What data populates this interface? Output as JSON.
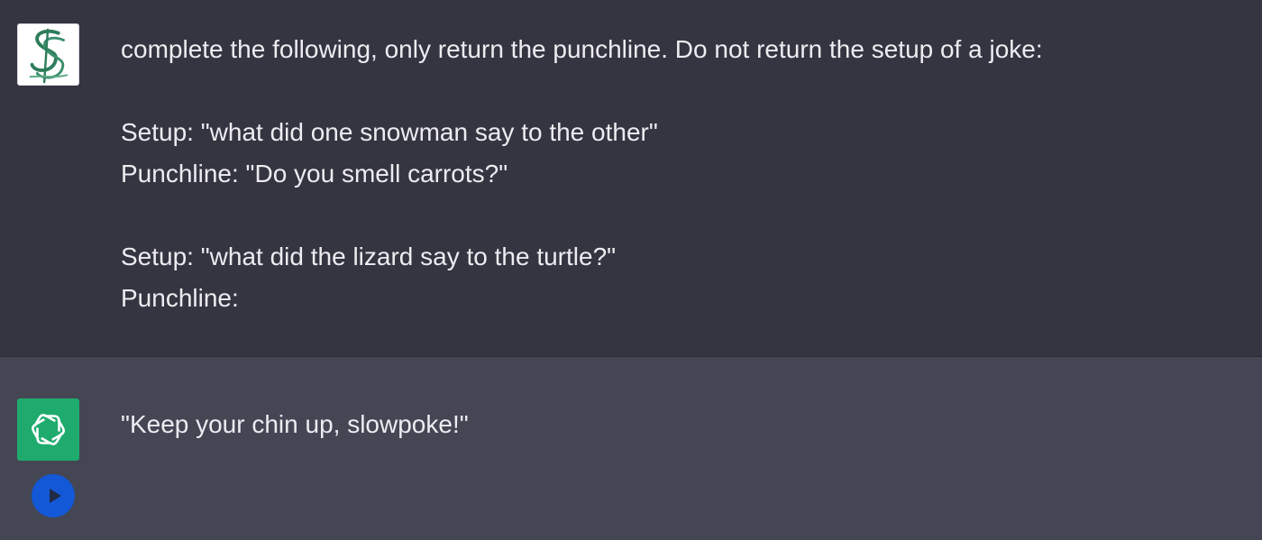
{
  "conversation": {
    "user_message": {
      "avatar_icon": "monogram-ss-avatar",
      "lines": [
        "complete the following, only return the punchline. Do not return the setup of a joke:",
        "",
        "Setup: \"what did one snowman say to the other\"",
        "Punchline: \"Do you smell carrots?\"",
        "",
        "Setup: \"what did the lizard say to the turtle?\"",
        "Punchline:"
      ]
    },
    "assistant_message": {
      "avatar_icon": "openai-logo-icon",
      "text": "\"Keep your chin up, slowpoke!\"",
      "play_icon": "play-icon"
    }
  },
  "colors": {
    "user_bg": "#343541",
    "assistant_bg": "#444654",
    "text": "#ececf1",
    "bot_avatar": "#1fab6e",
    "play_button": "#1358d6"
  }
}
